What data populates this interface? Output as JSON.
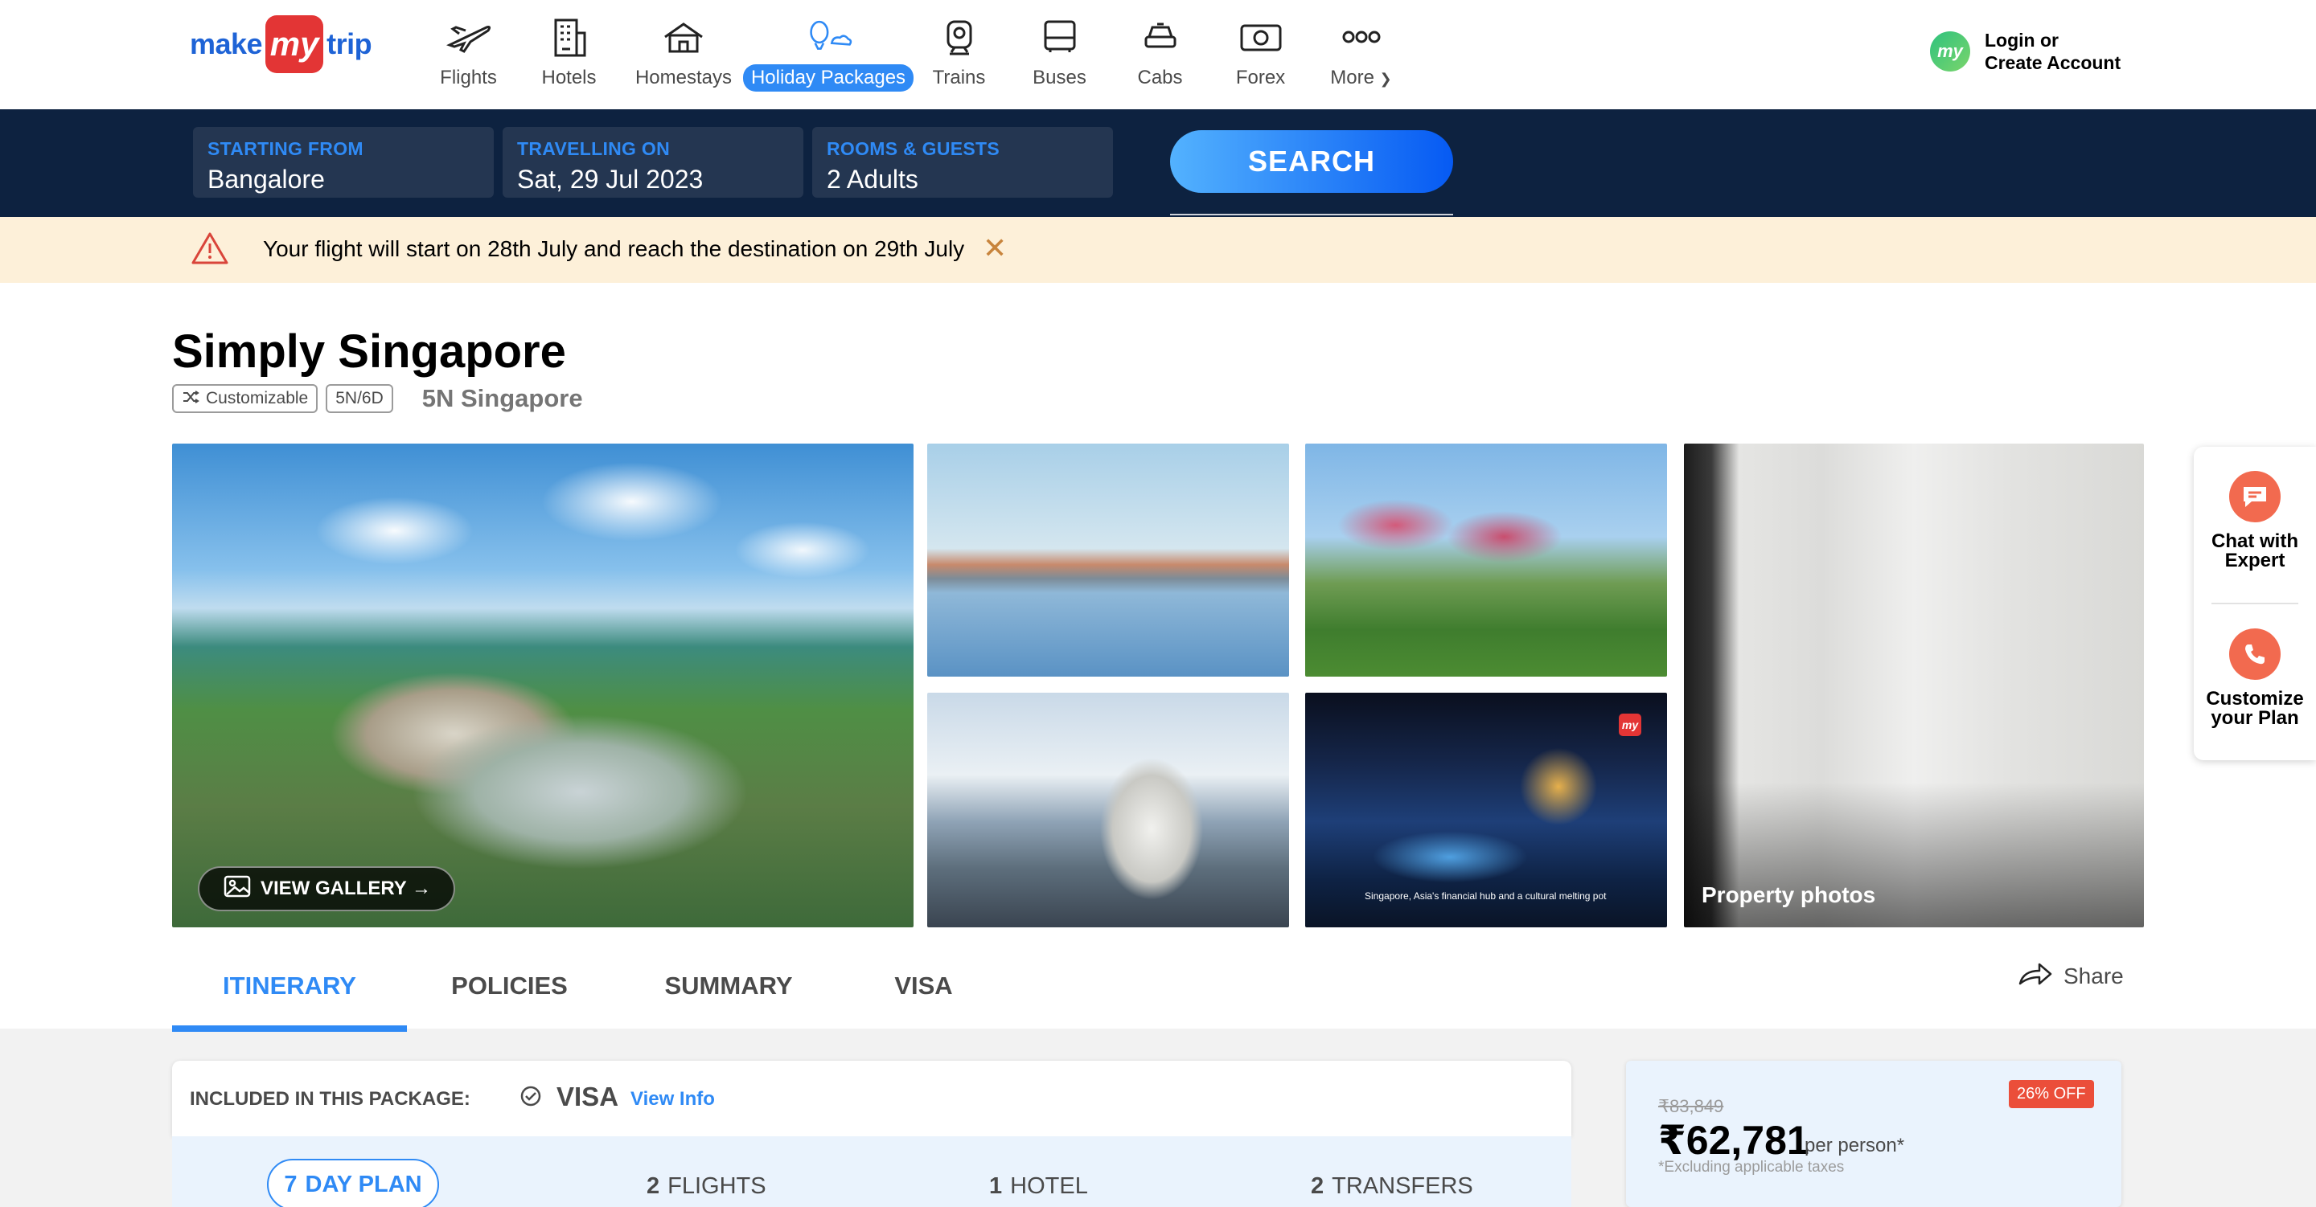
{
  "header": {
    "logo": {
      "make": "make",
      "my": "my",
      "trip": "trip"
    },
    "nav": [
      {
        "label": "Flights",
        "icon": "airplane-icon"
      },
      {
        "label": "Hotels",
        "icon": "hotel-building-icon"
      },
      {
        "label": "Homestays",
        "icon": "homestay-house-icon"
      },
      {
        "label": "Holiday Packages",
        "icon": "holiday-balloon-icon",
        "active": true
      },
      {
        "label": "Trains",
        "icon": "train-icon"
      },
      {
        "label": "Buses",
        "icon": "bus-icon"
      },
      {
        "label": "Cabs",
        "icon": "cab-icon"
      },
      {
        "label": "Forex",
        "icon": "forex-card-icon"
      },
      {
        "label": "More",
        "icon": "more-dots-icon"
      }
    ],
    "login": {
      "line1": "Login or",
      "line2": "Create Account",
      "avatar": "my"
    }
  },
  "search": {
    "starting_from": {
      "caption": "STARTING FROM",
      "value": "Bangalore"
    },
    "travelling_on": {
      "caption": "TRAVELLING ON",
      "value": "Sat, 29 Jul 2023"
    },
    "rooms_guests": {
      "caption": "ROOMS & GUESTS",
      "value": "2 Adults"
    },
    "button": "SEARCH"
  },
  "alert": {
    "message": "Your flight will start on 28th July and reach the destination on 29th July",
    "close": "✕"
  },
  "package": {
    "title": "Simply Singapore",
    "tags": [
      "Customizable",
      "5N/6D"
    ],
    "destination": "5N Singapore",
    "gallery_button": "VIEW GALLERY →",
    "photo_caption": "Singapore, Asia's financial hub and a cultural melting pot",
    "property_label": "Property photos"
  },
  "tabs": [
    {
      "label": "ITINERARY",
      "active": true
    },
    {
      "label": "POLICIES"
    },
    {
      "label": "SUMMARY"
    },
    {
      "label": "VISA"
    }
  ],
  "share": "Share",
  "side": {
    "chat": [
      "Chat with",
      "Expert"
    ],
    "customize": [
      "Customize",
      "your Plan"
    ]
  },
  "included": {
    "heading": "INCLUDED IN THIS PACKAGE:",
    "item": "VISA",
    "link": "View Info"
  },
  "plan": [
    {
      "num": "7",
      "label": "DAY PLAN"
    },
    {
      "num": "2",
      "label": "FLIGHTS"
    },
    {
      "num": "1",
      "label": "HOTEL"
    },
    {
      "num": "2",
      "label": "TRANSFERS"
    }
  ],
  "price": {
    "old": "₹83,849",
    "current": "₹62,781",
    "per": "per person*",
    "note": "*Excluding applicable taxes",
    "discount": "26% OFF"
  },
  "colors": {
    "brand_blue": "#2f8af5",
    "nav_dark": "#0d2240",
    "brand_red": "#e33535",
    "alert_bg": "#fdf0d9"
  }
}
